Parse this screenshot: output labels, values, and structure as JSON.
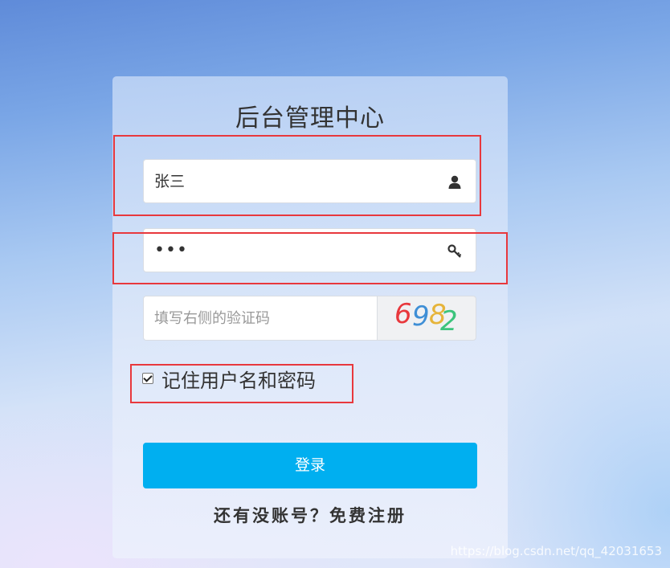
{
  "form": {
    "title": "后台管理中心",
    "username_value": "张三",
    "password_value": "•••",
    "captcha_placeholder": "填写右侧的验证码",
    "captcha_digits": [
      "6",
      "9",
      "8",
      "2"
    ],
    "captcha_colors": [
      "#e8383d",
      "#3f8fd6",
      "#e6b43a",
      "#3cc47c"
    ],
    "remember_label": "记住用户名和密码",
    "remember_checked": true,
    "login_label": "登录",
    "register_link": "还有没账号？免费注册"
  },
  "icons": {
    "username": "user-icon",
    "password": "key-icon"
  },
  "theme": {
    "accent": "#00aff0",
    "annotation": "#e8383d"
  },
  "watermark": "https://blog.csdn.net/qq_42031653"
}
